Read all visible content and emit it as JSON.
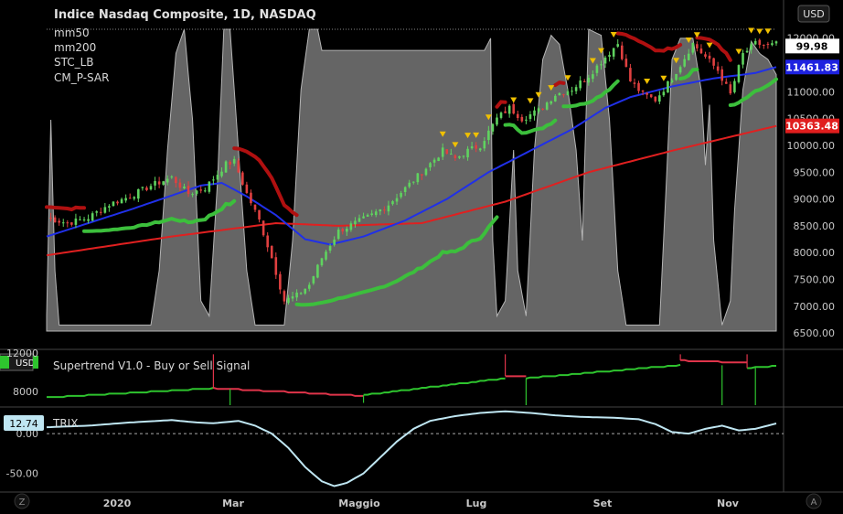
{
  "chart_data": {
    "type": "candlestick",
    "title": "Indice Nasdaq Composite, 1D, NASDAQ",
    "currency": "USD",
    "indicators": [
      "mm50",
      "mm200",
      "STC_LB",
      "CM_P-SAR"
    ],
    "x_ticks": [
      "2020",
      "Mar",
      "Maggio",
      "Lug",
      "Set",
      "Nov"
    ],
    "y_ticks": [
      12000,
      11500,
      11000,
      10500,
      10000,
      9500,
      9000,
      8500,
      8000,
      7500,
      7000,
      6500
    ],
    "ylim": [
      6400,
      12200
    ],
    "price_tags": [
      {
        "label": "99.98",
        "value": 11853,
        "color": "#ffffff",
        "text_color": "#000000"
      },
      {
        "label": "11461.83",
        "value": 11461.83,
        "color": "#1e22e0",
        "text_color": "#ffffff"
      },
      {
        "label": "10363.48",
        "value": 10363.48,
        "color": "#e01e1e",
        "text_color": "#ffffff"
      }
    ],
    "close_anchors": [
      {
        "x": 0,
        "y": 8650
      },
      {
        "x": 5,
        "y": 8550
      },
      {
        "x": 10,
        "y": 8650
      },
      {
        "x": 15,
        "y": 8900
      },
      {
        "x": 20,
        "y": 9050
      },
      {
        "x": 25,
        "y": 9250
      },
      {
        "x": 30,
        "y": 9400
      },
      {
        "x": 34,
        "y": 9100
      },
      {
        "x": 38,
        "y": 9200
      },
      {
        "x": 43,
        "y": 9650
      },
      {
        "x": 45,
        "y": 9700
      },
      {
        "x": 48,
        "y": 9100
      },
      {
        "x": 51,
        "y": 8600
      },
      {
        "x": 54,
        "y": 7900
      },
      {
        "x": 57,
        "y": 7100
      },
      {
        "x": 60,
        "y": 7200
      },
      {
        "x": 63,
        "y": 7400
      },
      {
        "x": 66,
        "y": 7900
      },
      {
        "x": 70,
        "y": 8400
      },
      {
        "x": 74,
        "y": 8550
      },
      {
        "x": 78,
        "y": 8700
      },
      {
        "x": 82,
        "y": 8900
      },
      {
        "x": 86,
        "y": 9200
      },
      {
        "x": 90,
        "y": 9500
      },
      {
        "x": 95,
        "y": 9900
      },
      {
        "x": 98,
        "y": 9750
      },
      {
        "x": 101,
        "y": 9900
      },
      {
        "x": 104,
        "y": 10000
      },
      {
        "x": 108,
        "y": 10500
      },
      {
        "x": 111,
        "y": 10700
      },
      {
        "x": 114,
        "y": 10500
      },
      {
        "x": 118,
        "y": 10650
      },
      {
        "x": 122,
        "y": 10950
      },
      {
        "x": 126,
        "y": 11050
      },
      {
        "x": 130,
        "y": 11300
      },
      {
        "x": 134,
        "y": 11650
      },
      {
        "x": 137,
        "y": 11900
      },
      {
        "x": 140,
        "y": 11200
      },
      {
        "x": 143,
        "y": 10950
      },
      {
        "x": 146,
        "y": 10850
      },
      {
        "x": 149,
        "y": 11150
      },
      {
        "x": 152,
        "y": 11500
      },
      {
        "x": 155,
        "y": 11900
      },
      {
        "x": 158,
        "y": 11650
      },
      {
        "x": 161,
        "y": 11400
      },
      {
        "x": 164,
        "y": 10950
      },
      {
        "x": 167,
        "y": 11700
      },
      {
        "x": 170,
        "y": 11900
      },
      {
        "x": 173,
        "y": 11853
      },
      {
        "x": 175,
        "y": 11890
      }
    ],
    "ma50_anchors": [
      {
        "x": 0,
        "y": 8300
      },
      {
        "x": 20,
        "y": 8800
      },
      {
        "x": 37,
        "y": 9250
      },
      {
        "x": 42,
        "y": 9300
      },
      {
        "x": 48,
        "y": 9050
      },
      {
        "x": 55,
        "y": 8700
      },
      {
        "x": 62,
        "y": 8250
      },
      {
        "x": 68,
        "y": 8150
      },
      {
        "x": 76,
        "y": 8300
      },
      {
        "x": 86,
        "y": 8600
      },
      {
        "x": 96,
        "y": 9000
      },
      {
        "x": 106,
        "y": 9500
      },
      {
        "x": 116,
        "y": 9900
      },
      {
        "x": 126,
        "y": 10300
      },
      {
        "x": 134,
        "y": 10700
      },
      {
        "x": 140,
        "y": 10900
      },
      {
        "x": 150,
        "y": 11100
      },
      {
        "x": 160,
        "y": 11250
      },
      {
        "x": 170,
        "y": 11350
      },
      {
        "x": 175,
        "y": 11462
      }
    ],
    "ma200_anchors": [
      {
        "x": 0,
        "y": 7950
      },
      {
        "x": 30,
        "y": 8300
      },
      {
        "x": 55,
        "y": 8550
      },
      {
        "x": 70,
        "y": 8500
      },
      {
        "x": 90,
        "y": 8550
      },
      {
        "x": 110,
        "y": 8950
      },
      {
        "x": 130,
        "y": 9500
      },
      {
        "x": 150,
        "y": 9900
      },
      {
        "x": 175,
        "y": 10363
      }
    ],
    "stc_anchors": [
      {
        "x": 0,
        "y": 5
      },
      {
        "x": 1,
        "y": 70
      },
      {
        "x": 2,
        "y": 20
      },
      {
        "x": 3,
        "y": 2
      },
      {
        "x": 25,
        "y": 2
      },
      {
        "x": 27,
        "y": 20
      },
      {
        "x": 29,
        "y": 60
      },
      {
        "x": 31,
        "y": 92
      },
      {
        "x": 33,
        "y": 100
      },
      {
        "x": 35,
        "y": 70
      },
      {
        "x": 37,
        "y": 10
      },
      {
        "x": 39,
        "y": 5
      },
      {
        "x": 41,
        "y": 50
      },
      {
        "x": 42.5,
        "y": 100
      },
      {
        "x": 44,
        "y": 100
      },
      {
        "x": 46,
        "y": 60
      },
      {
        "x": 48,
        "y": 20
      },
      {
        "x": 50,
        "y": 2
      },
      {
        "x": 57,
        "y": 2
      },
      {
        "x": 59,
        "y": 30
      },
      {
        "x": 61,
        "y": 80
      },
      {
        "x": 63,
        "y": 100
      },
      {
        "x": 65,
        "y": 100
      },
      {
        "x": 66,
        "y": 93
      },
      {
        "x": 100,
        "y": 93
      },
      {
        "x": 105,
        "y": 93
      },
      {
        "x": 106.5,
        "y": 97
      },
      {
        "x": 107,
        "y": 30
      },
      {
        "x": 108,
        "y": 5
      },
      {
        "x": 110,
        "y": 10
      },
      {
        "x": 112,
        "y": 60
      },
      {
        "x": 113,
        "y": 20
      },
      {
        "x": 115,
        "y": 5
      },
      {
        "x": 117,
        "y": 60
      },
      {
        "x": 119,
        "y": 90
      },
      {
        "x": 121,
        "y": 98
      },
      {
        "x": 123,
        "y": 95
      },
      {
        "x": 125,
        "y": 80
      },
      {
        "x": 127,
        "y": 60
      },
      {
        "x": 128.5,
        "y": 30
      },
      {
        "x": 130,
        "y": 100
      },
      {
        "x": 133,
        "y": 98
      },
      {
        "x": 135,
        "y": 70
      },
      {
        "x": 137,
        "y": 20
      },
      {
        "x": 139,
        "y": 2
      },
      {
        "x": 147,
        "y": 2
      },
      {
        "x": 149,
        "y": 60
      },
      {
        "x": 150,
        "y": 90
      },
      {
        "x": 152,
        "y": 97
      },
      {
        "x": 155,
        "y": 97
      },
      {
        "x": 157,
        "y": 80
      },
      {
        "x": 158,
        "y": 55
      },
      {
        "x": 159,
        "y": 75
      },
      {
        "x": 160,
        "y": 30
      },
      {
        "x": 162,
        "y": 2
      },
      {
        "x": 164,
        "y": 10
      },
      {
        "x": 165,
        "y": 40
      },
      {
        "x": 167,
        "y": 80
      },
      {
        "x": 169,
        "y": 96
      },
      {
        "x": 171,
        "y": 92
      },
      {
        "x": 173,
        "y": 90
      },
      {
        "x": 175,
        "y": 85
      }
    ],
    "psar_segments": [
      {
        "dir": "down",
        "from": 0,
        "to": 9
      },
      {
        "dir": "up",
        "from": 9,
        "to": 45
      },
      {
        "dir": "down",
        "from": 45,
        "to": 60
      },
      {
        "dir": "up",
        "from": 60,
        "to": 108
      },
      {
        "dir": "down",
        "from": 108,
        "to": 110
      },
      {
        "dir": "up",
        "from": 110,
        "to": 122
      },
      {
        "dir": "down",
        "from": 122,
        "to": 124
      },
      {
        "dir": "up",
        "from": 124,
        "to": 137
      },
      {
        "dir": "down",
        "from": 137,
        "to": 152
      },
      {
        "dir": "up",
        "from": 152,
        "to": 156
      },
      {
        "dir": "down",
        "from": 156,
        "to": 164
      },
      {
        "dir": "up",
        "from": 164,
        "to": 175
      }
    ],
    "supertrend": {
      "name": "Supertrend V1.0 - Buy or Sell Signal",
      "currency": "USD",
      "y_tick": "8000",
      "top_tick": "12000",
      "ylim": [
        6000,
        13000
      ],
      "segments": [
        {
          "dir": "up",
          "from": 0,
          "to": 40,
          "y0": 7000,
          "y1": 8200
        },
        {
          "dir": "down",
          "from": 40,
          "to": 76,
          "y0": 8200,
          "y1": 7200
        },
        {
          "dir": "up",
          "from": 76,
          "to": 110,
          "y0": 7300,
          "y1": 9500
        },
        {
          "dir": "down",
          "from": 110,
          "to": 115,
          "y0": 9800,
          "y1": 9800
        },
        {
          "dir": "up",
          "from": 115,
          "to": 152,
          "y0": 9500,
          "y1": 11200
        },
        {
          "dir": "down",
          "from": 152,
          "to": 168,
          "y0": 11800,
          "y1": 11500
        },
        {
          "dir": "up",
          "from": 168,
          "to": 175,
          "y0": 10800,
          "y1": 11100
        }
      ],
      "spikes": [
        {
          "x": 40,
          "y": 12600,
          "color": "#e0344a"
        },
        {
          "x": 44,
          "y": 4500,
          "color": "#2ec42e"
        },
        {
          "x": 76,
          "y": 6300,
          "color": "#2ec42e"
        },
        {
          "x": 110,
          "y": 12600,
          "color": "#e0344a"
        },
        {
          "x": 115,
          "y": 4500,
          "color": "#2ec42e"
        },
        {
          "x": 152,
          "y": 12600,
          "color": "#e0344a"
        },
        {
          "x": 162,
          "y": 4500,
          "color": "#2ec42e"
        },
        {
          "x": 168,
          "y": 12600,
          "color": "#e0344a"
        },
        {
          "x": 170,
          "y": 4500,
          "color": "#2ec42e"
        }
      ]
    },
    "trix": {
      "name": "TRIX",
      "last_label": "12.74",
      "y_ticks": [
        0,
        -50
      ],
      "y_tick_labels": [
        "0.00",
        "-50.00"
      ],
      "ylim": [
        -70,
        30
      ],
      "anchors": [
        {
          "x": 0,
          "y": 8
        },
        {
          "x": 10,
          "y": 10
        },
        {
          "x": 20,
          "y": 14
        },
        {
          "x": 30,
          "y": 17
        },
        {
          "x": 36,
          "y": 14
        },
        {
          "x": 40,
          "y": 13
        },
        {
          "x": 46,
          "y": 16
        },
        {
          "x": 50,
          "y": 10
        },
        {
          "x": 54,
          "y": 0
        },
        {
          "x": 58,
          "y": -18
        },
        {
          "x": 62,
          "y": -42
        },
        {
          "x": 66,
          "y": -60
        },
        {
          "x": 69,
          "y": -66
        },
        {
          "x": 72,
          "y": -62
        },
        {
          "x": 76,
          "y": -50
        },
        {
          "x": 80,
          "y": -30
        },
        {
          "x": 84,
          "y": -10
        },
        {
          "x": 88,
          "y": 6
        },
        {
          "x": 92,
          "y": 16
        },
        {
          "x": 98,
          "y": 22
        },
        {
          "x": 104,
          "y": 26
        },
        {
          "x": 110,
          "y": 28
        },
        {
          "x": 116,
          "y": 26
        },
        {
          "x": 122,
          "y": 23
        },
        {
          "x": 128,
          "y": 21
        },
        {
          "x": 136,
          "y": 20
        },
        {
          "x": 142,
          "y": 18
        },
        {
          "x": 146,
          "y": 12
        },
        {
          "x": 150,
          "y": 2
        },
        {
          "x": 154,
          "y": 0
        },
        {
          "x": 158,
          "y": 6
        },
        {
          "x": 162,
          "y": 10
        },
        {
          "x": 166,
          "y": 4
        },
        {
          "x": 170,
          "y": 6
        },
        {
          "x": 175,
          "y": 12.74
        }
      ]
    }
  },
  "corner": {
    "usd_label": "USD",
    "z_label": "Z",
    "a_label": "A"
  }
}
